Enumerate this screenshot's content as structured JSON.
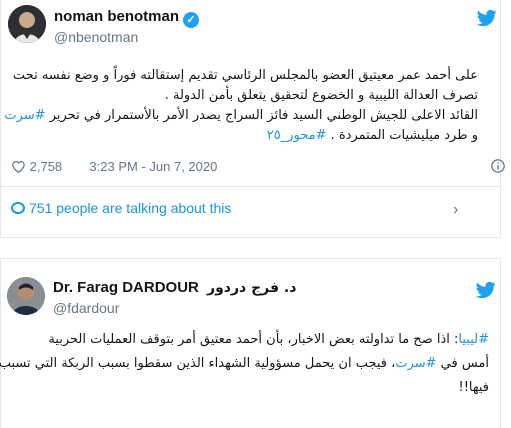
{
  "tweet1": {
    "display_name": "noman benotman",
    "handle": "@nbenotman",
    "lines": [
      "على أحمد عمر معيتيق العضو بالمجلس الرئاسي تقديم إستقالته فوراً و وضع نفسه تحت",
      "تصرف العدالة الليبية و الخضوع لتحقيق يتعلق بأمن الدولة .",
      "القائد الاعلى للجيش الوطني السيد فائز السراج يصدر الأمر بالأستمرار في تحرير",
      "و طرد ميليشيات المتمردة ."
    ],
    "hashtag_sirte": "#سرت",
    "hashtag_mehwar": "#محور_٢٥",
    "likes": "2,758",
    "time": "3:23 PM - Jun 7, 2020",
    "talking": "751 people are talking about this"
  },
  "tweet2": {
    "display_name": "Dr. Farag DARDOUR",
    "display_name_ar": "د. فرج دردور",
    "handle": "@fdardour",
    "hashtag_libya": "#ليبيا",
    "line1": ": اذا صح ما تداولته بعض الاخبار، بأن أحمد معتيق أمر بتوقف العمليات الحربية",
    "line2_a": "أمس في ",
    "hashtag_sirte": "#سرت",
    "line2_b": "، فيجب ان يحمل مسؤولية الشهداء الذين سقطوا بسبب الربكة التي تسبب",
    "line3": "فيها!!"
  },
  "colors": {
    "brand": "#1da1f2",
    "link": "#1b95e0",
    "muted": "#657786"
  },
  "icons": [
    "verified-badge-icon",
    "twitter-bird-icon",
    "heart-icon",
    "info-icon",
    "speech-bubble-icon",
    "chevron-right-icon"
  ]
}
